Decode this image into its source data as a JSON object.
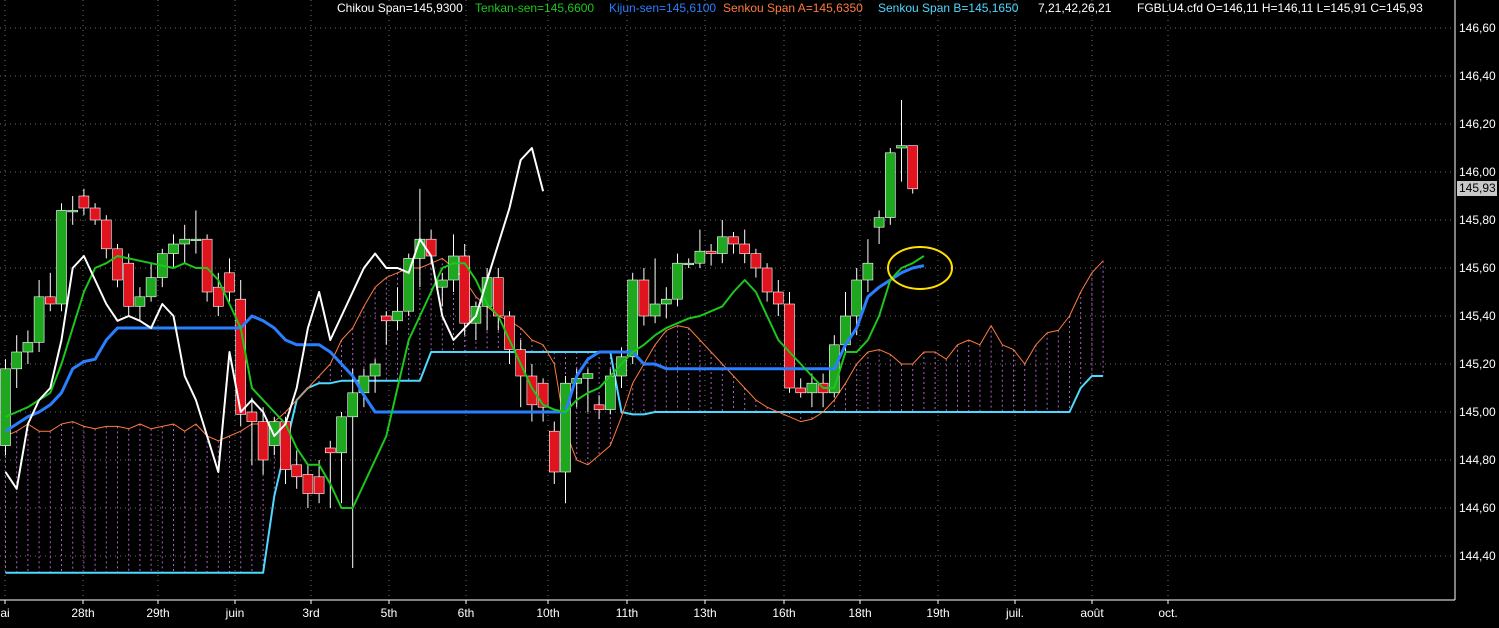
{
  "header": {
    "chikou": "Chikou Span=145,9300",
    "tenkan": "Tenkan-sen=145,6600",
    "kijun": "Kijun-sen=145,6100",
    "senkou_a": "Senkou Span A=145,6350",
    "senkou_b": "Senkou Span B=145,1650",
    "params": "7,21,42,26,21",
    "ohlc": "FGBLU4.cfd O=146,11 H=146,11 L=145,91 C=145,93"
  },
  "colors": {
    "background": "#000000",
    "grid": "#6e6e6e",
    "up_candle": "#1fa81f",
    "down_candle": "#e0141e",
    "chikou": "#ffffff",
    "tenkan": "#1bc81b",
    "kijun": "#2a7fff",
    "senkou_a": "#ff7a3c",
    "senkou_b": "#4fd8ff",
    "cloud": "#c06cd8",
    "highlight": "#ffe000"
  },
  "current_price": "145,93",
  "chart_data": {
    "type": "candlestick",
    "instrument": "FGBLU4.cfd",
    "ylim": [
      144.25,
      146.67
    ],
    "y_ticks": [
      "146,60",
      "146,40",
      "146,20",
      "146,00",
      "145,80",
      "145,60",
      "145,40",
      "145,20",
      "145,00",
      "144,80",
      "144,60",
      "144,40"
    ],
    "x_ticks": [
      "ai",
      "28th",
      "29th",
      "juin",
      "3rd",
      "5th",
      "6th",
      "10th",
      "11th",
      "13th",
      "16th",
      "18th",
      "19th",
      "juil.",
      "août",
      "oct."
    ],
    "grid": true,
    "candles": [
      {
        "o": 144.86,
        "h": 145.22,
        "l": 144.82,
        "c": 145.18
      },
      {
        "o": 145.18,
        "h": 145.32,
        "l": 145.1,
        "c": 145.25
      },
      {
        "o": 145.25,
        "h": 145.34,
        "l": 145.2,
        "c": 145.29
      },
      {
        "o": 145.29,
        "h": 145.55,
        "l": 145.25,
        "c": 145.48
      },
      {
        "o": 145.48,
        "h": 145.58,
        "l": 145.42,
        "c": 145.45
      },
      {
        "o": 145.45,
        "h": 145.87,
        "l": 145.42,
        "c": 145.84
      },
      {
        "o": 145.84,
        "h": 145.9,
        "l": 145.78,
        "c": 145.84
      },
      {
        "o": 145.9,
        "h": 145.93,
        "l": 145.82,
        "c": 145.85
      },
      {
        "o": 145.85,
        "h": 145.87,
        "l": 145.78,
        "c": 145.8
      },
      {
        "o": 145.8,
        "h": 145.82,
        "l": 145.64,
        "c": 145.68
      },
      {
        "o": 145.68,
        "h": 145.7,
        "l": 145.52,
        "c": 145.55
      },
      {
        "o": 145.62,
        "h": 145.66,
        "l": 145.4,
        "c": 145.44
      },
      {
        "o": 145.44,
        "h": 145.52,
        "l": 145.38,
        "c": 145.48
      },
      {
        "o": 145.48,
        "h": 145.62,
        "l": 145.46,
        "c": 145.56
      },
      {
        "o": 145.56,
        "h": 145.68,
        "l": 145.52,
        "c": 145.66
      },
      {
        "o": 145.66,
        "h": 145.74,
        "l": 145.6,
        "c": 145.7
      },
      {
        "o": 145.7,
        "h": 145.78,
        "l": 145.62,
        "c": 145.72
      },
      {
        "o": 145.72,
        "h": 145.84,
        "l": 145.66,
        "c": 145.72
      },
      {
        "o": 145.72,
        "h": 145.74,
        "l": 145.46,
        "c": 145.5
      },
      {
        "o": 145.52,
        "h": 145.58,
        "l": 145.4,
        "c": 145.44
      },
      {
        "o": 145.58,
        "h": 145.64,
        "l": 145.46,
        "c": 145.5
      },
      {
        "o": 145.47,
        "h": 145.55,
        "l": 144.94,
        "c": 144.99
      },
      {
        "o": 145.0,
        "h": 145.06,
        "l": 144.78,
        "c": 144.96
      },
      {
        "o": 144.96,
        "h": 145.02,
        "l": 144.74,
        "c": 144.8
      },
      {
        "o": 144.86,
        "h": 144.98,
        "l": 144.82,
        "c": 144.96
      },
      {
        "o": 144.96,
        "h": 144.98,
        "l": 144.7,
        "c": 144.76
      },
      {
        "o": 144.78,
        "h": 144.84,
        "l": 144.68,
        "c": 144.73
      },
      {
        "o": 144.74,
        "h": 144.78,
        "l": 144.6,
        "c": 144.66
      },
      {
        "o": 144.73,
        "h": 144.8,
        "l": 144.62,
        "c": 144.66
      },
      {
        "o": 144.85,
        "h": 144.88,
        "l": 144.6,
        "c": 144.83
      },
      {
        "o": 144.83,
        "h": 145.0,
        "l": 144.62,
        "c": 144.98
      },
      {
        "o": 144.98,
        "h": 145.18,
        "l": 144.35,
        "c": 145.08
      },
      {
        "o": 145.08,
        "h": 145.18,
        "l": 145.02,
        "c": 145.15
      },
      {
        "o": 145.15,
        "h": 145.22,
        "l": 145.08,
        "c": 145.2
      },
      {
        "o": 145.4,
        "h": 145.42,
        "l": 145.28,
        "c": 145.38
      },
      {
        "o": 145.38,
        "h": 145.52,
        "l": 145.34,
        "c": 145.42
      },
      {
        "o": 145.42,
        "h": 145.66,
        "l": 145.4,
        "c": 145.64
      },
      {
        "o": 145.64,
        "h": 145.93,
        "l": 145.52,
        "c": 145.72
      },
      {
        "o": 145.72,
        "h": 145.76,
        "l": 145.62,
        "c": 145.65
      },
      {
        "o": 145.52,
        "h": 145.58,
        "l": 145.44,
        "c": 145.55
      },
      {
        "o": 145.55,
        "h": 145.74,
        "l": 145.5,
        "c": 145.65
      },
      {
        "o": 145.65,
        "h": 145.7,
        "l": 145.32,
        "c": 145.37
      },
      {
        "o": 145.37,
        "h": 145.46,
        "l": 145.3,
        "c": 145.44
      },
      {
        "o": 145.44,
        "h": 145.6,
        "l": 145.34,
        "c": 145.56
      },
      {
        "o": 145.56,
        "h": 145.6,
        "l": 145.34,
        "c": 145.4
      },
      {
        "o": 145.4,
        "h": 145.42,
        "l": 145.2,
        "c": 145.26
      },
      {
        "o": 145.26,
        "h": 145.3,
        "l": 145.02,
        "c": 145.15
      },
      {
        "o": 145.15,
        "h": 145.2,
        "l": 144.96,
        "c": 145.03
      },
      {
        "o": 145.12,
        "h": 145.14,
        "l": 144.96,
        "c": 145.02
      },
      {
        "o": 144.92,
        "h": 144.96,
        "l": 144.7,
        "c": 144.75
      },
      {
        "o": 144.75,
        "h": 145.15,
        "l": 144.62,
        "c": 145.12
      },
      {
        "o": 145.12,
        "h": 145.18,
        "l": 145.02,
        "c": 145.14
      },
      {
        "o": 145.14,
        "h": 145.18,
        "l": 145.0,
        "c": 145.16
      },
      {
        "o": 145.03,
        "h": 145.07,
        "l": 144.97,
        "c": 145.01
      },
      {
        "o": 145.01,
        "h": 145.18,
        "l": 144.99,
        "c": 145.15
      },
      {
        "o": 145.15,
        "h": 145.27,
        "l": 145.1,
        "c": 145.23
      },
      {
        "o": 145.23,
        "h": 145.58,
        "l": 145.2,
        "c": 145.55
      },
      {
        "o": 145.55,
        "h": 145.6,
        "l": 145.36,
        "c": 145.4
      },
      {
        "o": 145.4,
        "h": 145.64,
        "l": 145.37,
        "c": 145.45
      },
      {
        "o": 145.45,
        "h": 145.52,
        "l": 145.39,
        "c": 145.47
      },
      {
        "o": 145.47,
        "h": 145.66,
        "l": 145.44,
        "c": 145.62
      },
      {
        "o": 145.62,
        "h": 145.64,
        "l": 145.6,
        "c": 145.62
      },
      {
        "o": 145.62,
        "h": 145.76,
        "l": 145.6,
        "c": 145.67
      },
      {
        "o": 145.67,
        "h": 145.7,
        "l": 145.61,
        "c": 145.66
      },
      {
        "o": 145.66,
        "h": 145.8,
        "l": 145.62,
        "c": 145.73
      },
      {
        "o": 145.73,
        "h": 145.75,
        "l": 145.66,
        "c": 145.7
      },
      {
        "o": 145.7,
        "h": 145.76,
        "l": 145.62,
        "c": 145.66
      },
      {
        "o": 145.66,
        "h": 145.68,
        "l": 145.56,
        "c": 145.6
      },
      {
        "o": 145.6,
        "h": 145.62,
        "l": 145.46,
        "c": 145.5
      },
      {
        "o": 145.5,
        "h": 145.55,
        "l": 145.4,
        "c": 145.45
      },
      {
        "o": 145.45,
        "h": 145.5,
        "l": 145.08,
        "c": 145.1
      },
      {
        "o": 145.1,
        "h": 145.14,
        "l": 145.06,
        "c": 145.08
      },
      {
        "o": 145.08,
        "h": 145.16,
        "l": 145.02,
        "c": 145.12
      },
      {
        "o": 145.12,
        "h": 145.16,
        "l": 145.02,
        "c": 145.08
      },
      {
        "o": 145.08,
        "h": 145.32,
        "l": 145.06,
        "c": 145.28
      },
      {
        "o": 145.28,
        "h": 145.5,
        "l": 145.24,
        "c": 145.4
      },
      {
        "o": 145.4,
        "h": 145.6,
        "l": 145.32,
        "c": 145.55
      },
      {
        "o": 145.55,
        "h": 145.72,
        "l": 145.5,
        "c": 145.62
      },
      {
        "o": 145.77,
        "h": 145.84,
        "l": 145.7,
        "c": 145.81
      },
      {
        "o": 145.81,
        "h": 146.1,
        "l": 145.78,
        "c": 146.08
      },
      {
        "o": 146.1,
        "h": 146.3,
        "l": 145.96,
        "c": 146.11
      },
      {
        "o": 146.11,
        "h": 146.11,
        "l": 145.91,
        "c": 145.93
      }
    ],
    "chikou": [
      144.75,
      144.68,
      144.95,
      145.05,
      145.1,
      145.3,
      145.6,
      145.65,
      145.55,
      145.45,
      145.38,
      145.4,
      145.38,
      145.35,
      145.45,
      145.4,
      145.15,
      145.05,
      144.9,
      144.75,
      145.25,
      145.0,
      145.05,
      145.0,
      144.9,
      144.95,
      145.1,
      145.35,
      145.5,
      145.3,
      145.4,
      145.5,
      145.6,
      145.66,
      145.6,
      145.6,
      145.58,
      145.72,
      145.65,
      145.4,
      145.3,
      145.35,
      145.4,
      145.55,
      145.7,
      145.85,
      146.05,
      146.1,
      145.92
    ],
    "tenkan": [
      144.98,
      145.0,
      145.02,
      145.05,
      145.08,
      145.2,
      145.35,
      145.5,
      145.6,
      145.62,
      145.65,
      145.64,
      145.63,
      145.62,
      145.61,
      145.6,
      145.62,
      145.6,
      145.6,
      145.55,
      145.45,
      145.35,
      145.1,
      145.05,
      145.0,
      144.95,
      144.85,
      144.78,
      144.78,
      144.7,
      144.6,
      144.6,
      144.7,
      144.8,
      144.9,
      145.1,
      145.3,
      145.4,
      145.5,
      145.6,
      145.62,
      145.62,
      145.55,
      145.45,
      145.4,
      145.3,
      145.2,
      145.1,
      145.03,
      145.01,
      145.0,
      145.05,
      145.08,
      145.1,
      145.15,
      145.2,
      145.25,
      145.28,
      145.32,
      145.35,
      145.37,
      145.39,
      145.4,
      145.42,
      145.44,
      145.5,
      145.55,
      145.5,
      145.4,
      145.3,
      145.25,
      145.2,
      145.15,
      145.1,
      145.1,
      145.25,
      145.25,
      145.3,
      145.4,
      145.55,
      145.6,
      145.62,
      145.65
    ],
    "kijun": [
      144.92,
      144.95,
      144.98,
      145.0,
      145.03,
      145.08,
      145.18,
      145.21,
      145.22,
      145.3,
      145.35,
      145.35,
      145.35,
      145.35,
      145.35,
      145.35,
      145.35,
      145.35,
      145.35,
      145.35,
      145.35,
      145.35,
      145.4,
      145.38,
      145.35,
      145.3,
      145.28,
      145.28,
      145.28,
      145.25,
      145.2,
      145.15,
      145.07,
      145.0,
      145.0,
      145.0,
      145.0,
      145.0,
      145.0,
      145.0,
      145.0,
      145.0,
      145.0,
      145.0,
      145.0,
      145.0,
      145.0,
      145.0,
      145.0,
      145.0,
      145.0,
      145.15,
      145.22,
      145.25,
      145.25,
      145.25,
      145.25,
      145.2,
      145.2,
      145.18,
      145.18,
      145.18,
      145.18,
      145.18,
      145.18,
      145.18,
      145.18,
      145.18,
      145.18,
      145.18,
      145.18,
      145.18,
      145.18,
      145.18,
      145.18,
      145.28,
      145.35,
      145.48,
      145.52,
      145.55,
      145.58,
      145.6,
      145.61
    ],
    "senkou_a": [
      144.9,
      144.92,
      144.95,
      144.92,
      144.92,
      144.95,
      144.96,
      144.94,
      144.93,
      144.94,
      144.94,
      144.93,
      144.95,
      144.93,
      144.94,
      144.95,
      144.92,
      144.95,
      144.9,
      144.88,
      144.9,
      144.92,
      144.95,
      144.95,
      144.96,
      145.0,
      145.05,
      145.1,
      145.15,
      145.2,
      145.3,
      145.35,
      145.44,
      145.52,
      145.56,
      145.58,
      145.6,
      145.6,
      145.62,
      145.64,
      145.6,
      145.55,
      145.48,
      145.44,
      145.4,
      145.38,
      145.35,
      145.3,
      145.28,
      145.2,
      144.92,
      144.8,
      144.78,
      144.82,
      144.86,
      144.98,
      145.12,
      145.2,
      145.28,
      145.34,
      145.36,
      145.35,
      145.3,
      145.25,
      145.2,
      145.15,
      145.1,
      145.05,
      145.02,
      145.0,
      144.98,
      144.96,
      144.97,
      145.0,
      145.05,
      145.12,
      145.2,
      145.25,
      145.26,
      145.24,
      145.2,
      145.2,
      145.25,
      145.25,
      145.22,
      145.28,
      145.3,
      145.28,
      145.36,
      145.28,
      145.26,
      145.2,
      145.28,
      145.33,
      145.34,
      145.4,
      145.5,
      145.58,
      145.63
    ],
    "senkou_b": [
      144.33,
      144.33,
      144.33,
      144.33,
      144.33,
      144.33,
      144.33,
      144.33,
      144.33,
      144.33,
      144.33,
      144.33,
      144.33,
      144.33,
      144.33,
      144.33,
      144.33,
      144.33,
      144.33,
      144.33,
      144.33,
      144.33,
      144.33,
      144.33,
      144.65,
      144.85,
      145.05,
      145.1,
      145.12,
      145.12,
      145.13,
      145.13,
      145.13,
      145.13,
      145.13,
      145.13,
      145.13,
      145.13,
      145.25,
      145.25,
      145.25,
      145.25,
      145.25,
      145.25,
      145.25,
      145.25,
      145.25,
      145.25,
      145.25,
      145.25,
      145.25,
      145.25,
      145.25,
      145.25,
      145.25,
      145.0,
      144.99,
      144.99,
      145.0,
      145.0,
      145.0,
      145.0,
      145.0,
      145.0,
      145.0,
      145.0,
      145.0,
      145.0,
      145.0,
      145.0,
      145.0,
      145.0,
      145.0,
      145.0,
      145.0,
      145.0,
      145.0,
      145.0,
      145.0,
      145.0,
      145.0,
      145.0,
      145.0,
      145.0,
      145.0,
      145.0,
      145.0,
      145.0,
      145.0,
      145.0,
      145.0,
      145.0,
      145.0,
      145.0,
      145.0,
      145.0,
      145.1,
      145.15,
      145.15
    ]
  }
}
